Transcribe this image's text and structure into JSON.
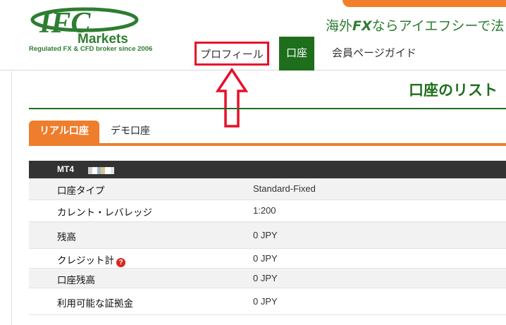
{
  "brand": {
    "logo_text_top": "IFC",
    "logo_text_bottom": "Markets",
    "tagline": "Regulated FX & CFD broker since 2006",
    "slogan_prefix": "海外",
    "slogan_fx": "FX",
    "slogan_suffix": "ならアイエフシーで法",
    "green": "#1f6e1c",
    "orange": "#ee7d2d"
  },
  "nav": {
    "profile": "プロフィール",
    "account": "口座",
    "guide": "会員ページガイド"
  },
  "annotation": {
    "highlight_color": "#e8102a"
  },
  "page": {
    "title": "口座のリスト"
  },
  "tabs": {
    "real": "リアル口座",
    "demo": "デモ口座"
  },
  "account": {
    "platform": "MT4",
    "rows": [
      {
        "label": "口座タイプ",
        "value": "Standard-Fixed"
      },
      {
        "label": "カレント・レバレッジ",
        "value": "1:200"
      },
      {
        "label": "残高",
        "value": "0 JPY"
      },
      {
        "label": "クレジット計",
        "value": "0 JPY",
        "help": "?"
      },
      {
        "label": "口座残高",
        "value": "0 JPY"
      },
      {
        "label": "利用可能な証拠金",
        "value": "0 JPY"
      }
    ]
  }
}
